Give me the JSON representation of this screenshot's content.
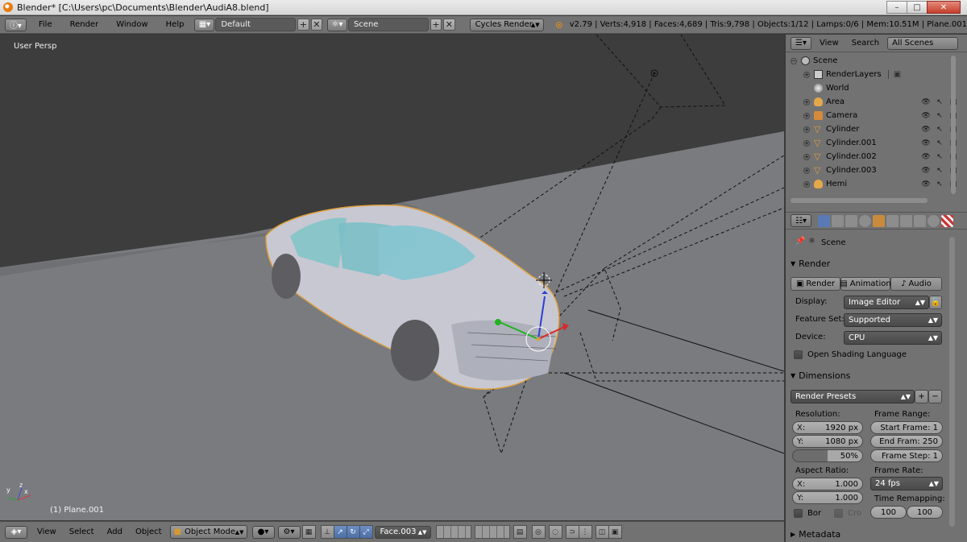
{
  "window": {
    "title": "Blender* [C:\\Users\\pc\\Documents\\Blender\\AudiA8.blend]",
    "min": "–",
    "max": "□",
    "close": "✕"
  },
  "info_header": {
    "menus": [
      "File",
      "Render",
      "Window",
      "Help"
    ],
    "layout": "Default",
    "scene": "Scene",
    "engine": "Cycles Render",
    "stats": "v2.79 | Verts:4,918 | Faces:4,689 | Tris:9,798 | Objects:1/12 | Lamps:0/6 | Mem:10.51M | Plane.001"
  },
  "viewport": {
    "view_label": "User Persp",
    "object_label": "(1) Plane.001"
  },
  "view3d_header": {
    "menus": [
      "View",
      "Select",
      "Add",
      "Object"
    ],
    "mode": "Object Mode",
    "orientation": "Face.003"
  },
  "outliner": {
    "header": {
      "view": "View",
      "search": "Search",
      "filter": "All Scenes"
    },
    "items": [
      {
        "name": "Scene",
        "icon": "scene-icon",
        "level": 0
      },
      {
        "name": "RenderLayers",
        "icon": "renderlayers-icon",
        "level": 1
      },
      {
        "name": "World",
        "icon": "world-icon",
        "level": 1
      },
      {
        "name": "Area",
        "icon": "lamp-icon",
        "level": 1
      },
      {
        "name": "Camera",
        "icon": "camera-icon",
        "level": 1
      },
      {
        "name": "Cylinder",
        "icon": "mesh-icon",
        "level": 1
      },
      {
        "name": "Cylinder.001",
        "icon": "mesh-icon",
        "level": 1
      },
      {
        "name": "Cylinder.002",
        "icon": "mesh-icon",
        "level": 1
      },
      {
        "name": "Cylinder.003",
        "icon": "mesh-icon",
        "level": 1
      },
      {
        "name": "Hemi",
        "icon": "lamp-icon",
        "level": 1
      }
    ]
  },
  "properties": {
    "context": "Scene",
    "render_section": "Render",
    "render_buttons": [
      "Render",
      "Animation",
      "Audio"
    ],
    "display_label": "Display:",
    "display_value": "Image Editor",
    "feature_set_label": "Feature Set:",
    "feature_set_value": "Supported",
    "device_label": "Device:",
    "device_value": "CPU",
    "osl_label": "Open Shading Language",
    "dimensions_section": "Dimensions",
    "render_presets": "Render Presets",
    "resolution_label": "Resolution:",
    "res_x_label": "X:",
    "res_x": "1920 px",
    "res_y_label": "Y:",
    "res_y": "1080 px",
    "res_pct": "50%",
    "frame_range_label": "Frame Range:",
    "start_frame": "Start Frame: 1",
    "end_frame": "End Fram: 250",
    "frame_step": "Frame Step: 1",
    "aspect_label": "Aspect Ratio:",
    "aspect_x_label": "X:",
    "aspect_x": "1.000",
    "aspect_y_label": "Y:",
    "aspect_y": "1.000",
    "frame_rate_label": "Frame Rate:",
    "frame_rate": "24 fps",
    "time_remap_label": "Time Remapping:",
    "time_old": "100",
    "time_new": "100",
    "border_label": "Bor",
    "crop_label": "Cro",
    "metadata_section": "Metadata"
  }
}
